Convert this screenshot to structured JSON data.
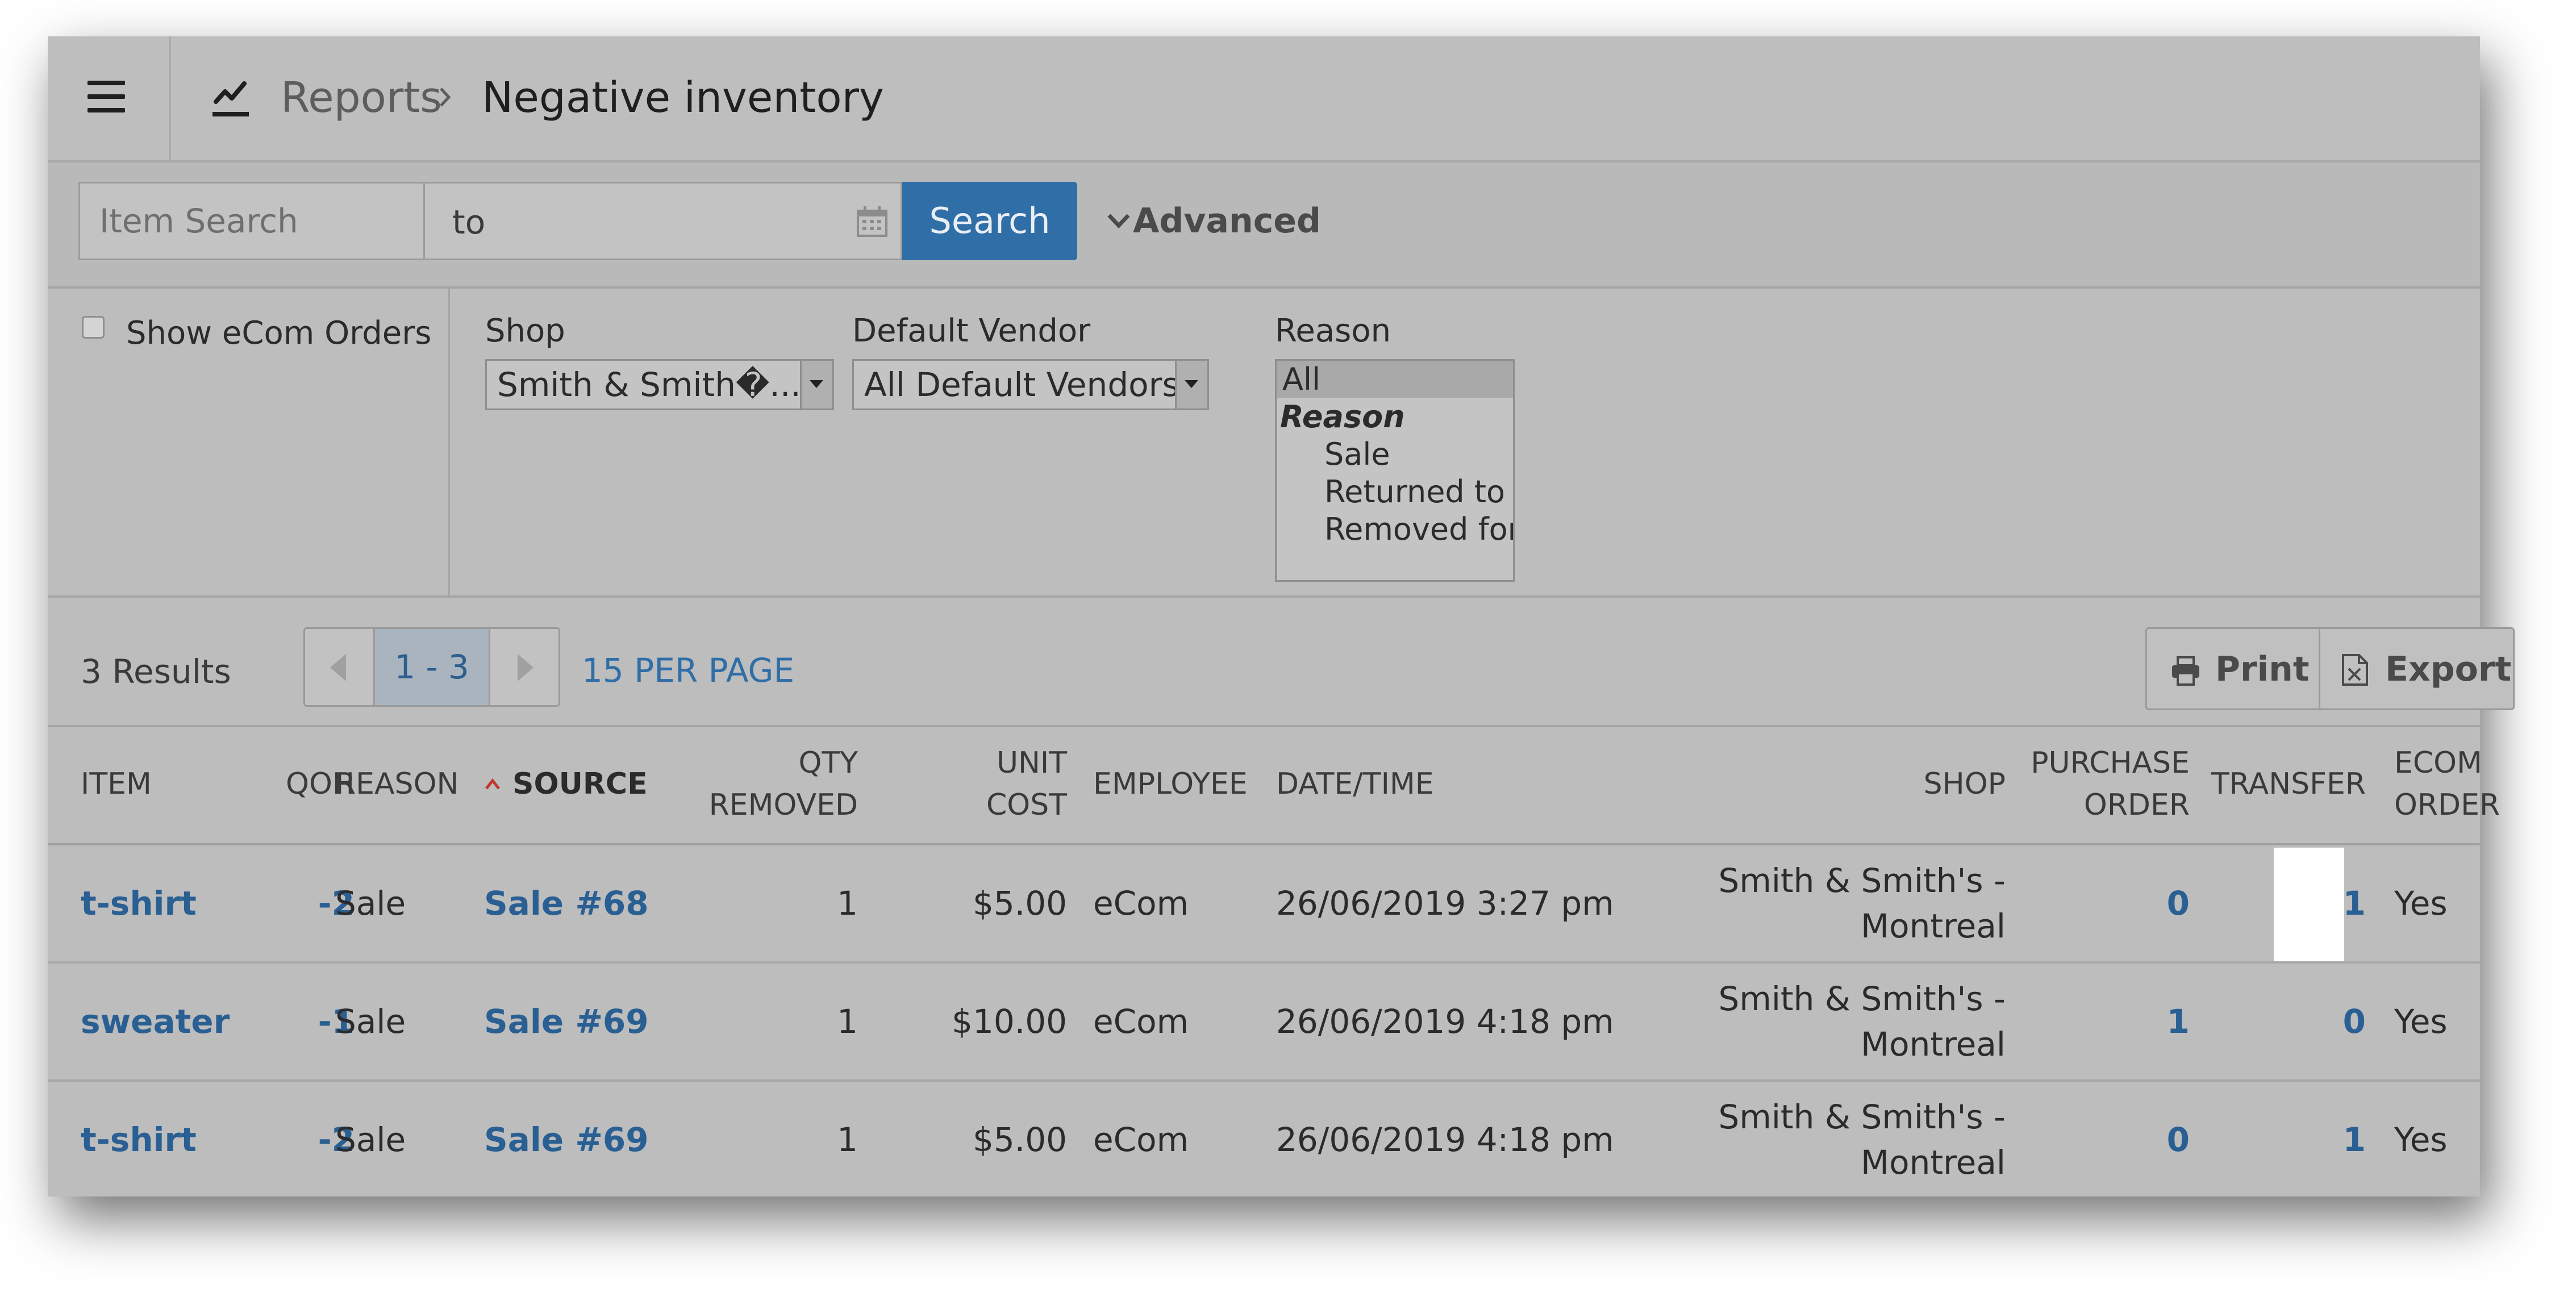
{
  "header": {
    "breadcrumb_parent": "Reports",
    "breadcrumb_current": "Negative inventory"
  },
  "search": {
    "item_placeholder": "Item Search",
    "date_range_text": "to",
    "search_label": "Search",
    "advanced_label": "Advanced"
  },
  "filters": {
    "show_ecom_label": "Show eCom Orders",
    "shop_label": "Shop",
    "shop_value": "Smith & Smith�...",
    "vendor_label": "Default Vendor",
    "vendor_value": "All Default Vendors",
    "reason_label": "Reason",
    "reason_options": {
      "all": "All",
      "group": "Reason",
      "sale": "Sale",
      "returned": "Returned to vendor",
      "removed": "Removed for transfer"
    }
  },
  "results": {
    "count_text": "3 Results",
    "page_range": "1 - 3",
    "per_page": "15 PER PAGE",
    "print_label": "Print",
    "export_label": "Export"
  },
  "table": {
    "headers": {
      "item": "ITEM",
      "qoh": "QOH",
      "reason": "REASON",
      "source": "SOURCE",
      "qty_removed_1": "QTY",
      "qty_removed_2": "REMOVED",
      "unit_cost_1": "UNIT",
      "unit_cost_2": "COST",
      "employee": "EMPLOYEE",
      "datetime": "DATE/TIME",
      "shop": "SHOP",
      "po_1": "PURCHASE",
      "po_2": "ORDER",
      "transfer": "TRANSFER",
      "ecom_1": "ECOM",
      "ecom_2": "ORDER"
    },
    "rows": [
      {
        "item": "t-shirt",
        "qoh": "-2",
        "reason": "Sale",
        "source": "Sale #68",
        "qty": "1",
        "cost": "$5.00",
        "employee": "eCom",
        "datetime": "26/06/2019 3:27 pm",
        "shop_1": "Smith & Smith's -",
        "shop_2": "Montreal",
        "po": "0",
        "transfer": "1",
        "ecom": "Yes"
      },
      {
        "item": "sweater",
        "qoh": "-1",
        "reason": "Sale",
        "source": "Sale #69",
        "qty": "1",
        "cost": "$10.00",
        "employee": "eCom",
        "datetime": "26/06/2019 4:18 pm",
        "shop_1": "Smith & Smith's -",
        "shop_2": "Montreal",
        "po": "1",
        "transfer": "0",
        "ecom": "Yes"
      },
      {
        "item": "t-shirt",
        "qoh": "-2",
        "reason": "Sale",
        "source": "Sale #69",
        "qty": "1",
        "cost": "$5.00",
        "employee": "eCom",
        "datetime": "26/06/2019 4:18 pm",
        "shop_1": "Smith & Smith's -",
        "shop_2": "Montreal",
        "po": "0",
        "transfer": "1",
        "ecom": "Yes"
      }
    ]
  },
  "icons": {
    "menu": "hamburger-icon",
    "report": "chart-check-icon",
    "calendar": "calendar-icon",
    "print": "printer-icon",
    "export": "spreadsheet-icon"
  },
  "colors": {
    "accent": "#2f6ea7",
    "link": "#2a5f93",
    "sort_caret": "#c0392b"
  }
}
